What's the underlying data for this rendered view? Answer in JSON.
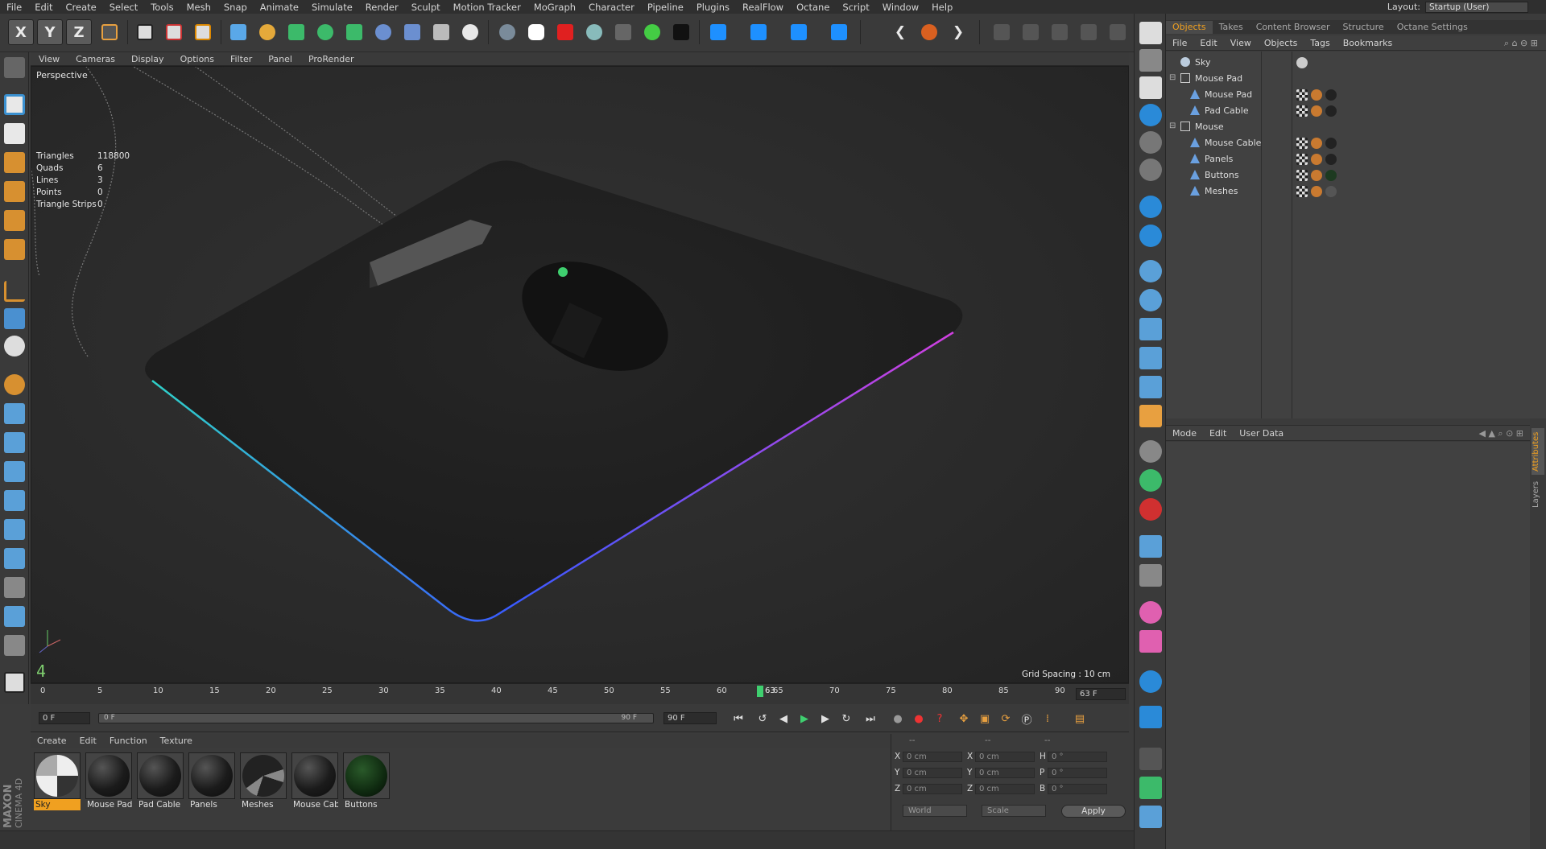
{
  "menubar": {
    "items": [
      "File",
      "Edit",
      "Create",
      "Select",
      "Tools",
      "Mesh",
      "Snap",
      "Animate",
      "Simulate",
      "Render",
      "Sculpt",
      "Motion Tracker",
      "MoGraph",
      "Character",
      "Pipeline",
      "Plugins",
      "RealFlow",
      "Octane",
      "Script",
      "Window",
      "Help"
    ],
    "layout_label": "Layout:",
    "layout_value": "Startup (User)"
  },
  "toolbar": {
    "axis_x": "X",
    "axis_y": "Y",
    "axis_z": "Z"
  },
  "viewport": {
    "menu": [
      "View",
      "Cameras",
      "Display",
      "Options",
      "Filter",
      "Panel",
      "ProRender"
    ],
    "label": "Perspective",
    "stats": [
      {
        "k": "Triangles",
        "v": "118800"
      },
      {
        "k": "Quads",
        "v": "6"
      },
      {
        "k": "Lines",
        "v": "3"
      },
      {
        "k": "Points",
        "v": "0"
      },
      {
        "k": "Triangle Strips",
        "v": "0"
      }
    ],
    "grid_spacing": "Grid Spacing : 10 cm",
    "corner_number": "4"
  },
  "timeline": {
    "ticks": [
      "0",
      "5",
      "10",
      "15",
      "20",
      "25",
      "30",
      "35",
      "40",
      "45",
      "50",
      "55",
      "60",
      "65",
      "70",
      "75",
      "80",
      "85",
      "90"
    ],
    "current_marker": "63",
    "current_frame_field": "63 F",
    "start_field": "0 F",
    "range_start": "0 F",
    "range_end": "90 F",
    "end_field": "90 F"
  },
  "materials": {
    "menu": [
      "Create",
      "Edit",
      "Function",
      "Texture"
    ],
    "items": [
      {
        "name": "Sky",
        "selected": true
      },
      {
        "name": "Mouse Pad",
        "selected": false
      },
      {
        "name": "Pad Cable",
        "selected": false
      },
      {
        "name": "Panels",
        "selected": false
      },
      {
        "name": "Meshes",
        "selected": false
      },
      {
        "name": "Mouse Cab",
        "selected": false
      },
      {
        "name": "Buttons",
        "selected": false
      }
    ]
  },
  "coords": {
    "header_1": "--",
    "header_2": "--",
    "header_3": "--",
    "rows": [
      {
        "l1": "X",
        "v1": "0 cm",
        "l2": "X",
        "v2": "0 cm",
        "l3": "H",
        "v3": "0 °"
      },
      {
        "l1": "Y",
        "v1": "0 cm",
        "l2": "Y",
        "v2": "0 cm",
        "l3": "P",
        "v3": "0 °"
      },
      {
        "l1": "Z",
        "v1": "0 cm",
        "l2": "Z",
        "v2": "0 cm",
        "l3": "B",
        "v3": "0 °"
      }
    ],
    "world": "World",
    "scale": "Scale",
    "apply": "Apply"
  },
  "object_manager": {
    "tabs": [
      "Objects",
      "Takes",
      "Content Browser",
      "Structure",
      "Octane Settings"
    ],
    "menu": [
      "File",
      "Edit",
      "View",
      "Objects",
      "Tags",
      "Bookmarks"
    ],
    "objects": [
      {
        "name": "Sky",
        "level": 0
      },
      {
        "name": "Mouse Pad",
        "level": 0
      },
      {
        "name": "Mouse Pad",
        "level": 1
      },
      {
        "name": "Pad Cable",
        "level": 1
      },
      {
        "name": "Mouse",
        "level": 0
      },
      {
        "name": "Mouse Cable",
        "level": 1
      },
      {
        "name": "Panels",
        "level": 1
      },
      {
        "name": "Buttons",
        "level": 1
      },
      {
        "name": "Meshes",
        "level": 1
      }
    ]
  },
  "attributes": {
    "menu": [
      "Mode",
      "Edit",
      "User Data"
    ],
    "side_tabs": [
      "Attributes",
      "Layers"
    ]
  },
  "branding": {
    "line1": "MAXON",
    "line2": "CINEMA 4D"
  },
  "colors": {
    "accent": "#f0a020",
    "timeline_marker": "#3fcf6f"
  }
}
